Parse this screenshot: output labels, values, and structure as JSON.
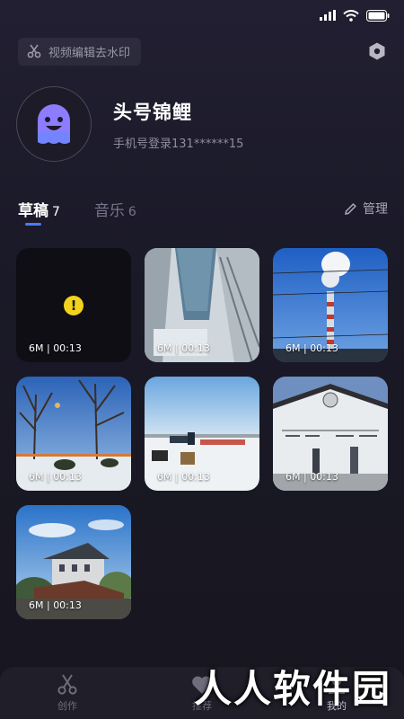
{
  "status_bar": {
    "icons": [
      "signal-icon",
      "wifi-icon",
      "battery-icon"
    ]
  },
  "topbar": {
    "watermark_label": "视频编辑去水印",
    "settings_icon": "hexagon-settings-icon"
  },
  "profile": {
    "username": "头号锦鲤",
    "phone": "手机号登录131******15"
  },
  "tabs": [
    {
      "label": "草稿",
      "count": "7",
      "active": true
    },
    {
      "label": "音乐",
      "count": "6",
      "active": false
    }
  ],
  "manage_label": "管理",
  "drafts": [
    {
      "meta": "6M | 00:13",
      "scene": "error"
    },
    {
      "meta": "6M | 00:13",
      "scene": "snowy-building"
    },
    {
      "meta": "6M | 00:13",
      "scene": "chimney"
    },
    {
      "meta": "6M | 00:13",
      "scene": "winter-trees"
    },
    {
      "meta": "6M | 00:13",
      "scene": "frozen-lake"
    },
    {
      "meta": "6M | 00:13",
      "scene": "mural-wall"
    },
    {
      "meta": "6M | 00:13",
      "scene": "temple"
    }
  ],
  "bottom_nav": [
    {
      "label": "创作",
      "icon": "scissors-icon"
    },
    {
      "label": "推荐",
      "icon": "heart-icon"
    },
    {
      "label": "我的",
      "icon": "user-icon"
    }
  ],
  "site_watermark": "人人软件园",
  "colors": {
    "accent": "#4b7bff",
    "warning": "#f2d21b",
    "avatar": "#8e7cff"
  }
}
